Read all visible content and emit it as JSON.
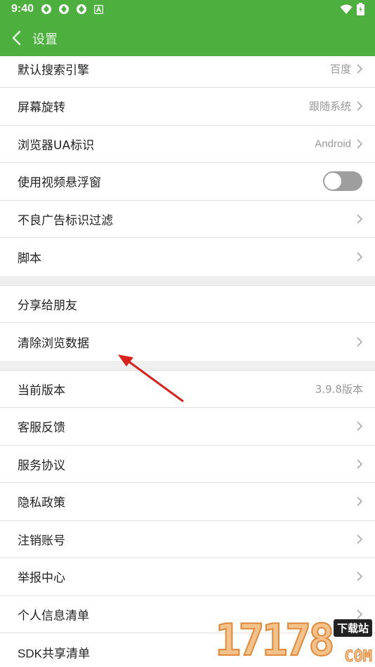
{
  "status_bar": {
    "time": "9:40",
    "notification_icons": [
      "app-notification-icon",
      "app-notification-icon",
      "app-notification-icon",
      "a-badge-icon"
    ],
    "system_icons": [
      "wifi-icon",
      "battery-icon"
    ]
  },
  "app_bar": {
    "title": "设置",
    "back_icon": "chevron-left-icon"
  },
  "groups": {
    "general": [
      {
        "label": "默认搜索引擎",
        "value": "百度"
      },
      {
        "label": "屏幕旋转",
        "value": "跟随系统"
      },
      {
        "label": "浏览器UA标识",
        "value": "Android"
      },
      {
        "label": "使用视频悬浮窗",
        "toggle": "off"
      },
      {
        "label": "不良广告标识过滤"
      },
      {
        "label": "脚本"
      }
    ],
    "data": [
      {
        "label": "分享给朋友"
      },
      {
        "label": "清除浏览数据"
      }
    ],
    "about": [
      {
        "label": "当前版本",
        "value": "3.9.8版本"
      },
      {
        "label": "客服反馈"
      },
      {
        "label": "服务协议"
      },
      {
        "label": "隐私政策"
      },
      {
        "label": "注销账号"
      },
      {
        "label": "举报中心"
      },
      {
        "label": "个人信息清单"
      },
      {
        "label": "SDK共享清单"
      }
    ]
  },
  "annotation": {
    "type": "red-arrow",
    "points_to": "清除浏览数据"
  },
  "watermark": {
    "digits": "17178",
    "badge": "下载站",
    "suffix": "COM"
  },
  "colors": {
    "accent": "#4caf3e",
    "annotation": "#d9221c",
    "divider": "#e2e2e2"
  }
}
